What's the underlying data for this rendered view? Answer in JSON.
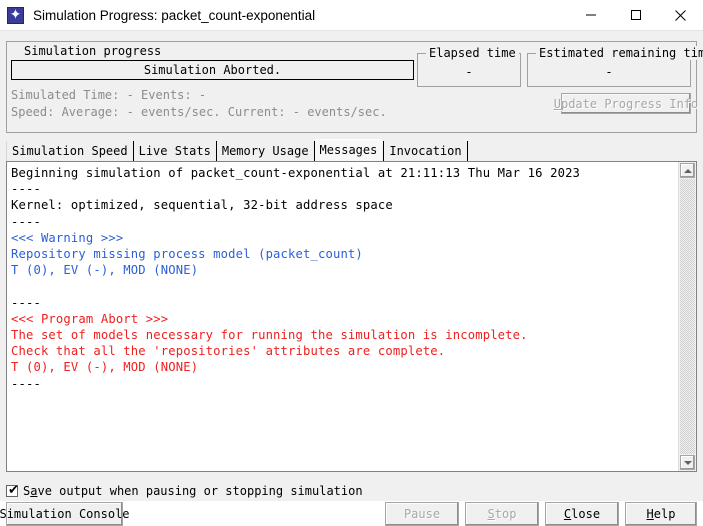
{
  "window": {
    "title": "Simulation Progress: packet_count-exponential",
    "icon": "app-starburst-icon",
    "minimize_label": "–",
    "maximize_label": "☐",
    "close_label": "✕"
  },
  "progress_group": {
    "legend": "Simulation progress",
    "progress_text": "Simulation Aborted.",
    "progress_percent": 0,
    "stat_line_1": "Simulated Time: - Events: -",
    "stat_line_2": "Speed: Average: - events/sec. Current: - events/sec.",
    "update_button": {
      "mnemonic": "U",
      "label_rest": "pdate Progress Info",
      "enabled": false
    },
    "elapsed": {
      "legend": "Elapsed time",
      "value": "-"
    },
    "remaining": {
      "legend": "Estimated remaining time",
      "value": "-"
    }
  },
  "tabs": [
    {
      "label": "Simulation Speed",
      "selected": false
    },
    {
      "label": "Live Stats",
      "selected": false
    },
    {
      "label": "Memory Usage",
      "selected": false
    },
    {
      "label": "Messages",
      "selected": true
    },
    {
      "label": "Invocation",
      "selected": false
    }
  ],
  "log": {
    "lines": [
      {
        "text": "Beginning simulation of packet_count-exponential at 21:11:13 Thu Mar 16 2023",
        "style": "normal"
      },
      {
        "text": "----",
        "style": "normal"
      },
      {
        "text": "Kernel: optimized, sequential, 32-bit address space",
        "style": "normal"
      },
      {
        "text": "----",
        "style": "normal"
      },
      {
        "text": "<<< Warning >>>",
        "style": "warn"
      },
      {
        "text": "Repository missing process model (packet_count)",
        "style": "warn"
      },
      {
        "text": "T (0), EV (-), MOD (NONE)",
        "style": "warn"
      },
      {
        "text": "",
        "style": "normal"
      },
      {
        "text": "----",
        "style": "normal"
      },
      {
        "text": "<<< Program Abort >>>",
        "style": "error"
      },
      {
        "text": "The set of models necessary for running the simulation is incomplete.",
        "style": "error"
      },
      {
        "text": "Check that all the 'repositories' attributes are complete.",
        "style": "error"
      },
      {
        "text": "T (0), EV (-), MOD (NONE)",
        "style": "error"
      },
      {
        "text": "----",
        "style": "normal"
      }
    ],
    "scrollbar": {
      "up_arrow": "scroll-up-icon",
      "down_arrow": "scroll-down-icon"
    }
  },
  "save_option": {
    "checked": true,
    "check_glyph": "✔",
    "prefix": "S",
    "mnemonic": "a",
    "suffix": "ve output when pausing or stopping simulation"
  },
  "buttons": {
    "console": {
      "label": "Simulation Console",
      "enabled": true
    },
    "pause": {
      "label": "Pause",
      "enabled": false
    },
    "stop": {
      "mnemonic": "S",
      "label_rest": "top",
      "enabled": false
    },
    "close": {
      "mnemonic": "C",
      "label_rest": "lose",
      "enabled": true
    },
    "help": {
      "mnemonic": "H",
      "label_rest": "elp",
      "enabled": true
    }
  },
  "colors": {
    "warning_text": "#2b5fd9",
    "error_text": "#ef2020",
    "disabled_text": "#a8a8a8",
    "window_bg": "#f0f0f0",
    "log_bg": "#ffffff"
  }
}
